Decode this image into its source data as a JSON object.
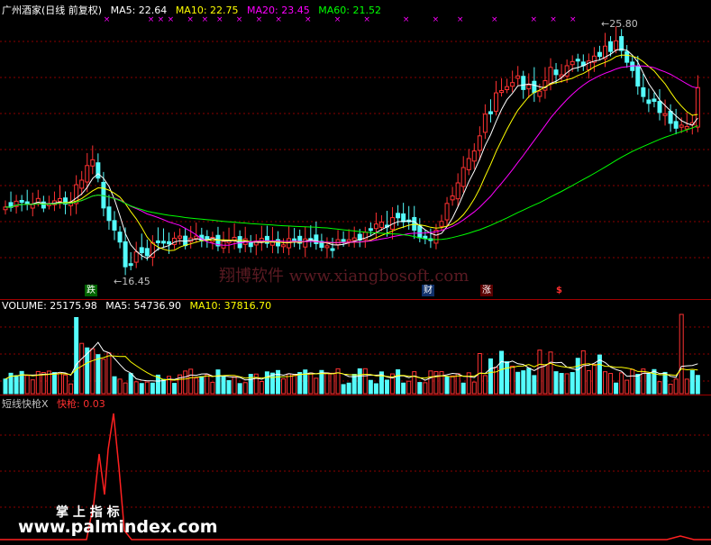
{
  "price_panel": {
    "title": "广州酒家(日线 前复权)",
    "indicators": [
      {
        "label": "MA5: 22.64",
        "color": "#ffffff"
      },
      {
        "label": "MA10: 22.75",
        "color": "#ffff00"
      },
      {
        "label": "MA20: 23.45",
        "color": "#ff00ff"
      },
      {
        "label": "MA60: 21.52",
        "color": "#00ff00"
      }
    ],
    "high_label": "25.80",
    "low_label": "16.45",
    "markers": {
      "die": "跌",
      "cai": "财",
      "zhang": "涨",
      "dollar": "$"
    },
    "watermark": "翔博软件 www.xiangbosoft.com"
  },
  "volume_panel": {
    "indicators": [
      {
        "label": "VOLUME: 25175.98",
        "color": "#ffffff"
      },
      {
        "label": "MA5: 54736.90",
        "color": "#ffffff"
      },
      {
        "label": "MA10: 37816.70",
        "color": "#ffff00"
      }
    ]
  },
  "signal_panel": {
    "indicators": [
      {
        "label": "短线快枪X",
        "color": "#c0c0c0"
      },
      {
        "label": "快枪: 0.03",
        "color": "#ff3030"
      }
    ],
    "brand_cn": "掌 上 指 标",
    "brand_url": "www.palmindex.com"
  },
  "colors": {
    "up": "#ff3232",
    "down": "#54fcfc",
    "ma5": "#ffffff",
    "ma10": "#ffff00",
    "ma20": "#ff00ff",
    "ma60": "#00ff00"
  }
}
